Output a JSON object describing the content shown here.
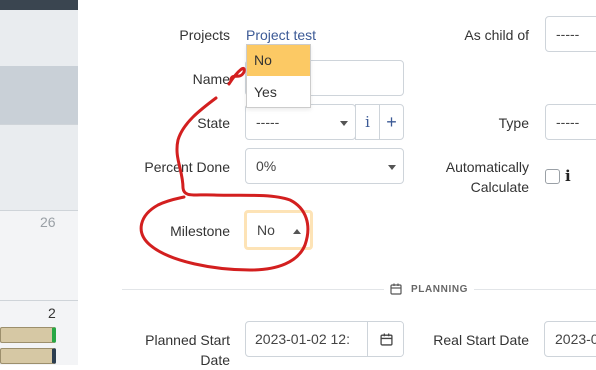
{
  "calendar": {
    "day_a": "26",
    "day_b": "2"
  },
  "form": {
    "projects_label": "Projects",
    "projects_value": "Project test",
    "as_child_of_label": "As child of",
    "as_child_of_value": "-----",
    "name_label": "Name",
    "state_label": "State",
    "state_value": "-----",
    "info_glyph": "i",
    "add_glyph": "+",
    "type_label": "Type",
    "type_value": "-----",
    "percent_label": "Percent Done",
    "percent_value": "0%",
    "auto_calc_label_1": "Automatically",
    "auto_calc_label_2": "Calculate",
    "milestone_label": "Milestone",
    "milestone_value": "No",
    "planning_header": "PLANNING",
    "planned_start_label_1": "Planned Start",
    "planned_start_label_2": "Date",
    "planned_start_value": "2023-01-02 12:",
    "real_start_label": "Real Start Date",
    "real_start_value": "2023-0"
  },
  "milestone_dropdown": {
    "options": [
      "No",
      "Yes"
    ],
    "highlighted": "No",
    "highlight_color": "#fcc964"
  },
  "annotation": {
    "color": "#d31f1f"
  }
}
